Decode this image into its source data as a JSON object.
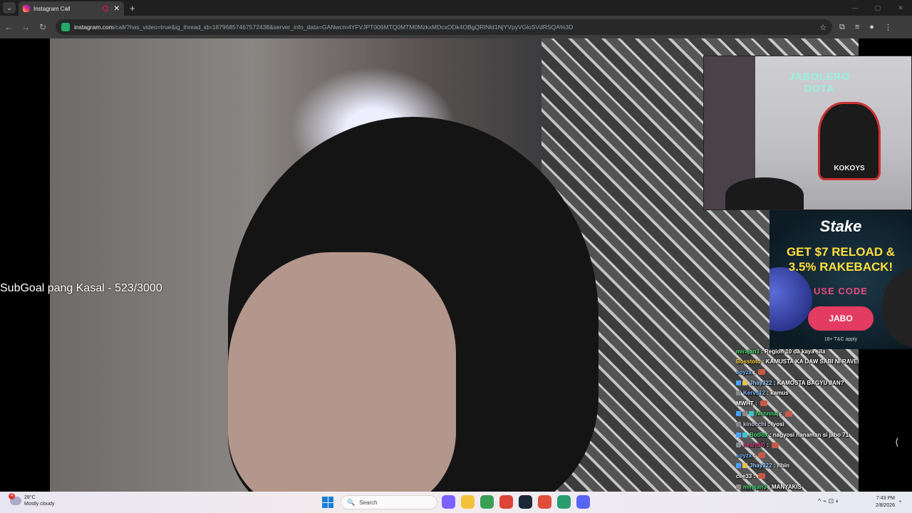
{
  "browser": {
    "tab_title": "Instagram Call",
    "tab_close": "✕",
    "new_tab": "+",
    "tab_menu": "⌄",
    "url_host": "instagram.com",
    "url_rest": "/call/?has_video=true&ig_thread_id=18796857467572438&server_info_data=GANwcm4YFVJPT006MTQ0MTM0MzkxMDcxODk4OBgQRlNld1NjYVpyVGloSVdRSQA%3D",
    "nav_back": "←",
    "nav_forward": "→",
    "nav_reload": "↻",
    "star": "☆",
    "window_controls": {
      "minimize": "—",
      "maximize": "▢",
      "close": "✕"
    }
  },
  "overlay": {
    "subgoal_text": "SubGoal pang Kasal - 523/3000"
  },
  "webcam": {
    "neon_line1": "JABOLERO",
    "neon_line2": "DOTA",
    "logo_text": "KOKOYS"
  },
  "ad": {
    "brand": "Stake",
    "headline_line1": "GET $7 RELOAD &",
    "headline_line2": "3.5% RAKEBACK!",
    "use_code": "USE CODE",
    "code": "JABO",
    "terms": "18+ T&C apply"
  },
  "chat": [
    {
      "user": "mirajan3",
      "user_color": "#4fe07a",
      "message": "Region 10 da kaya sila",
      "badges": [],
      "emote": false
    },
    {
      "user": "Bosstoto",
      "user_color": "#ffd84a",
      "message": "KAMUSTA KA DAW SABI NI RAVEN",
      "badges": [],
      "emote": false
    },
    {
      "user": "soyzx",
      "user_color": "#7ab6ff",
      "message": "",
      "badges": [],
      "emote": true
    },
    {
      "user": "Jhay322",
      "user_color": "#9ad0ff",
      "message": "KAMOSTA BAGYU JAN?",
      "badges": [
        "#4aa3ff",
        "#e5c04a"
      ],
      "emote": false
    },
    {
      "user": "Kervs12",
      "user_color": "#7ab6ff",
      "message": "kamus",
      "badges": [
        "#8a8a8a"
      ],
      "emote": false
    },
    {
      "user": "MWHT",
      "user_color": "#ffffff",
      "message": "",
      "badges": [],
      "emote": true
    },
    {
      "user": "Nsnnnaj",
      "user_color": "#4fe07a",
      "message": "",
      "badges": [
        "#4aa3ff",
        "#8a8a8a",
        "#3ec3c9"
      ],
      "emote": true
    },
    {
      "user": "kinocchi",
      "user_color": "#cfcfe8",
      "message": "lyosi",
      "badges": [
        "#8a8a8a"
      ],
      "emote": false
    },
    {
      "user": "BotRix",
      "user_color": "#4fe07a",
      "message": "nagyosi nanaman si jabo 71",
      "badges": [
        "#4aa3ff",
        "#3ec3c9"
      ],
      "emote": false
    },
    {
      "user": "heartbl0",
      "user_color": "#e04a8a",
      "message": "",
      "badges": [
        "#8a8a8a"
      ],
      "emote": true
    },
    {
      "user": "soyzx",
      "user_color": "#7ab6ff",
      "message": "",
      "badges": [],
      "emote": true
    },
    {
      "user": "Jhay322",
      "user_color": "#9ad0ff",
      "message": "ribin",
      "badges": [
        "#4aa3ff",
        "#e5c04a"
      ],
      "emote": false
    },
    {
      "user": "cee33",
      "user_color": "#ffffff",
      "message": "",
      "badges": [],
      "emote": true
    },
    {
      "user": "mirajan3",
      "user_color": "#4fe07a",
      "message": "MANYAKIS",
      "badges": [
        "#8a8a8a"
      ],
      "emote": false
    },
    {
      "user": "soyzx",
      "user_color": "#7ab6ff",
      "message": "raven doran",
      "badges": [],
      "emote": false
    },
    {
      "user": "huckyfinn1437",
      "user_color": "#c9b3ff",
      "message": "ravendota2",
      "badges": [
        "#8a8a8a"
      ],
      "emote": false
    }
  ],
  "taskbar": {
    "weather_temp": "28°C",
    "weather_desc": "Mostly cloudy",
    "weather_badge": "4",
    "search_placeholder": "Search",
    "search_icon": "🔍",
    "apps": [
      {
        "name": "copilot",
        "color": "#7b61ff"
      },
      {
        "name": "file-explorer",
        "color": "#f2c23b"
      },
      {
        "name": "chrome-profile",
        "color": "#3b9e55"
      },
      {
        "name": "chrome",
        "color": "#db4437"
      },
      {
        "name": "steam",
        "color": "#1b2838"
      },
      {
        "name": "chrome-alt",
        "color": "#e04e3a"
      },
      {
        "name": "terminal",
        "color": "#2a9d6e"
      },
      {
        "name": "discord",
        "color": "#5865f2"
      }
    ],
    "time": "7:43 PM",
    "date": "2/8/2026",
    "tray_icons": "^  ⌁  ⊡  ◐",
    "bell": "🔔"
  },
  "scroll_hint": "⟨"
}
